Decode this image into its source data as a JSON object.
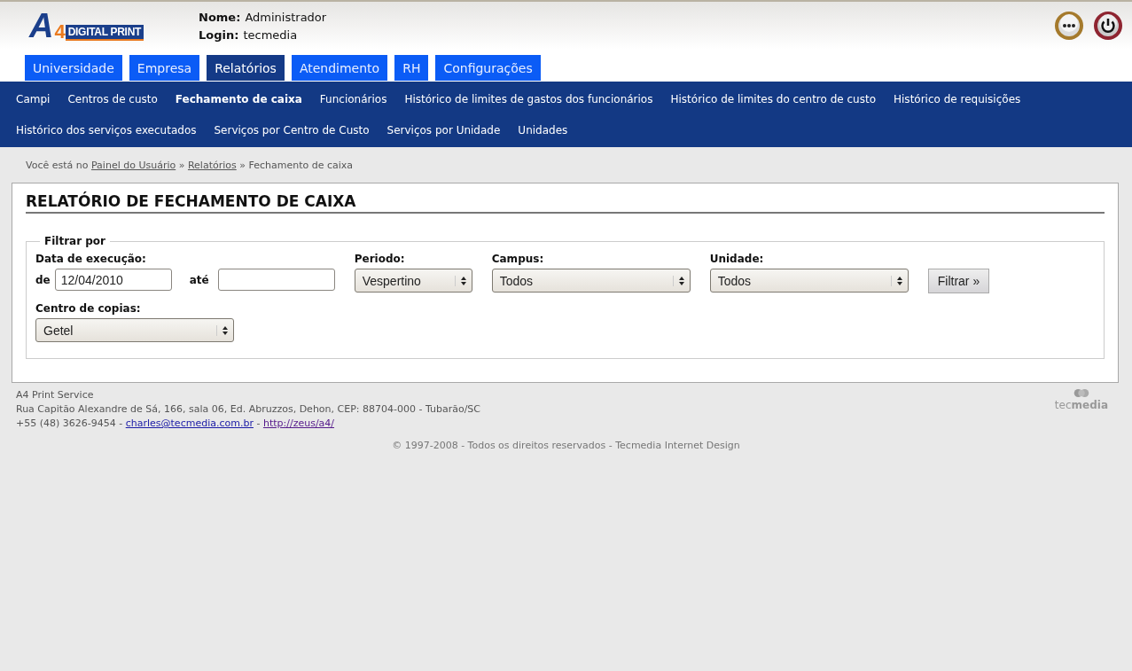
{
  "logo": {
    "letter": "A",
    "digit": "4",
    "text": "DIGITAL PRINT"
  },
  "user": [
    {
      "label": "Nome:",
      "value": "Administrador"
    },
    {
      "label": "Login:",
      "value": "tecmedia"
    }
  ],
  "tabs": [
    {
      "label": "Universidade",
      "selected": false
    },
    {
      "label": "Empresa",
      "selected": false
    },
    {
      "label": "Relatórios",
      "selected": true
    },
    {
      "label": "Atendimento",
      "selected": false
    },
    {
      "label": "RH",
      "selected": false
    },
    {
      "label": "Configurações",
      "selected": false
    }
  ],
  "submenu": [
    {
      "label": "Campi",
      "selected": false
    },
    {
      "label": "Centros de custo",
      "selected": false
    },
    {
      "label": "Fechamento de caixa",
      "selected": true
    },
    {
      "label": "Funcionários",
      "selected": false
    },
    {
      "label": "Histórico de limites de gastos dos funcionários",
      "selected": false
    },
    {
      "label": "Histórico de limites do centro de custo",
      "selected": false
    },
    {
      "label": "Histórico de requisições",
      "selected": false
    },
    {
      "label": "Histórico dos serviços executados",
      "selected": false
    },
    {
      "label": "Serviços por Centro de Custo",
      "selected": false
    },
    {
      "label": "Serviços por Unidade",
      "selected": false
    },
    {
      "label": "Unidades",
      "selected": false
    }
  ],
  "breadcrumb": [
    {
      "kind": "text",
      "text": "Você está no"
    },
    {
      "kind": "link",
      "text": "Painel do Usuário"
    },
    {
      "kind": "text",
      "text": "»"
    },
    {
      "kind": "link",
      "text": "Relatórios"
    },
    {
      "kind": "text",
      "text": "» Fechamento de caixa"
    }
  ],
  "page_title": "RELATÓRIO DE FECHAMENTO DE CAIXA",
  "filter": {
    "legend": "Filtrar por",
    "date": {
      "label": "Data de execução:",
      "from_label": "de",
      "from_value": "12/04/2010",
      "to_label": "até"
    },
    "selects": [
      {
        "label": "Periodo:",
        "value": "Vespertino"
      },
      {
        "label": "Campus:",
        "value": "Todos"
      },
      {
        "label": "Unidade:",
        "value": "Todos"
      }
    ],
    "button": "Filtrar »",
    "copy_center": {
      "label": "Centro de copias:",
      "value": "Getel"
    }
  },
  "footer": {
    "company": "A4 Print Service",
    "address": "Rua Capitão Alexandre de Sá, 166, sala 06, Ed. Abruzzos, Dehon, CEP: 88704-000 - Tubarão/SC",
    "contact": [
      {
        "kind": "text",
        "text": "+55 (48) 3626-9454 -"
      },
      {
        "kind": "link",
        "text": "charles@tecmedia.com.br"
      },
      {
        "kind": "text",
        "text": "-"
      },
      {
        "kind": "visited",
        "text": "http://zeus/a4/"
      }
    ],
    "brand": {
      "light": "tec",
      "bold": "media"
    },
    "copyright": "© 1997-2008 - Todos os direitos reservados - Tecmedia Internet Design"
  }
}
